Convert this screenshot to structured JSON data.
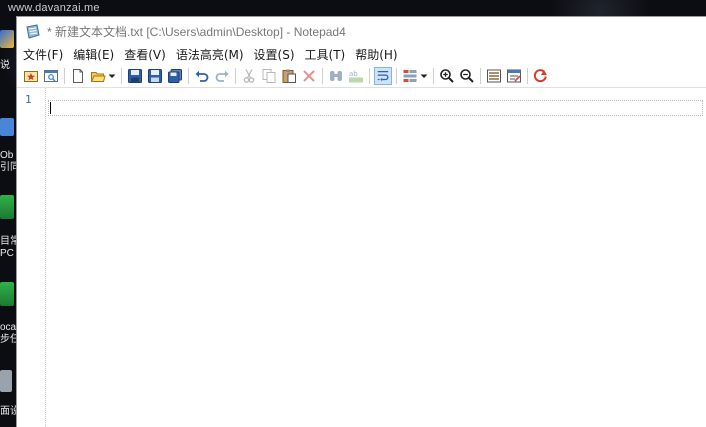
{
  "watermark": "www.davanzai.me",
  "window": {
    "title": "* 新建文本文档.txt [C:\\Users\\admin\\Desktop] - Notepad4"
  },
  "menu": [
    "文件(F)",
    "编辑(E)",
    "查看(V)",
    "语法高亮(M)",
    "设置(S)",
    "工具(T)",
    "帮助(H)"
  ],
  "toolbar": {
    "icons": [
      "favorites-icon",
      "open-browse-icon",
      "new-file-icon",
      "open-folder-icon",
      "save-icon",
      "save-as-icon",
      "save-copy-icon",
      "undo-icon",
      "redo-icon",
      "cut-icon",
      "copy-icon",
      "paste-icon",
      "delete-icon",
      "find-icon",
      "replace-icon",
      "word-wrap-icon",
      "scheme-icon",
      "zoom-in-icon",
      "zoom-out-icon",
      "toggle-folds-icon",
      "insert-icon",
      "exit-icon"
    ]
  },
  "editor": {
    "line_numbers": [
      "1"
    ],
    "content": ""
  },
  "desktop_labels": [
    "说",
    "Ob",
    "引同",
    "目常",
    "PC",
    "oca",
    "步任",
    "面设"
  ],
  "colors": {
    "accent": "#2b6cb0",
    "title_text": "#777777",
    "active_tool_bg": "#cde3f7"
  }
}
